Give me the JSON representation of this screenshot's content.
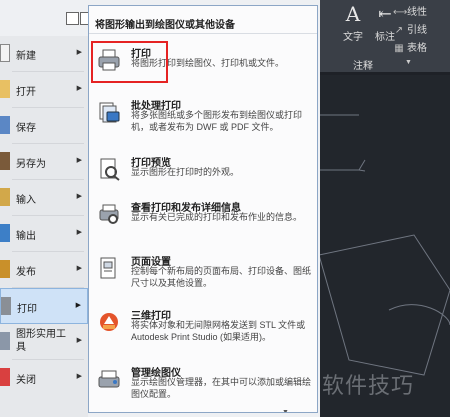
{
  "ribbon": {
    "text_label": "文字",
    "dim_label": "标注",
    "linetype_label": "线性",
    "leader_label": "引线",
    "table_label": "表格",
    "annotation_label": "注释"
  },
  "left_menu": {
    "items": [
      {
        "label": "新建",
        "has_submenu": true
      },
      {
        "label": "打开",
        "has_submenu": true
      },
      {
        "label": "保存",
        "has_submenu": false
      },
      {
        "label": "另存为",
        "has_submenu": true
      },
      {
        "label": "输入",
        "has_submenu": true
      },
      {
        "label": "输出",
        "has_submenu": true
      },
      {
        "label": "发布",
        "has_submenu": true
      },
      {
        "label": "打印",
        "has_submenu": true,
        "active": true
      },
      {
        "label": "图形实用工具",
        "has_submenu": true
      },
      {
        "label": "关闭",
        "has_submenu": true
      }
    ]
  },
  "panel": {
    "header": "将图形输出到绘图仪或其他设备",
    "items": [
      {
        "title": "打印",
        "desc": "将图形打印到绘图仪、打印机或文件。"
      },
      {
        "title": "批处理打印",
        "desc": "将多张图纸或多个图形发布到绘图仪或打印机，或者发布为 DWF 或 PDF 文件。"
      },
      {
        "title": "打印预览",
        "desc": "显示图形在打印时的外观。"
      },
      {
        "title": "查看打印和发布详细信息",
        "desc": "显示有关已完成的打印和发布作业的信息。"
      },
      {
        "title": "页面设置",
        "desc": "控制每个新布局的页面布局、打印设备、图纸尺寸以及其他设置。"
      },
      {
        "title": "三维打印",
        "desc": "将实体对象和无间隙网格发送到 STL 文件或 Autodesk Print Studio (如果适用)。"
      },
      {
        "title": "管理绘图仪",
        "desc": "显示绘图仪管理器，在其中可以添加或编辑绘图仪配置。"
      }
    ]
  },
  "watermark": "软件技巧",
  "colors": {
    "highlight": "#e52323",
    "active_bg": "#cfe2f7",
    "canvas": "#22262c"
  }
}
